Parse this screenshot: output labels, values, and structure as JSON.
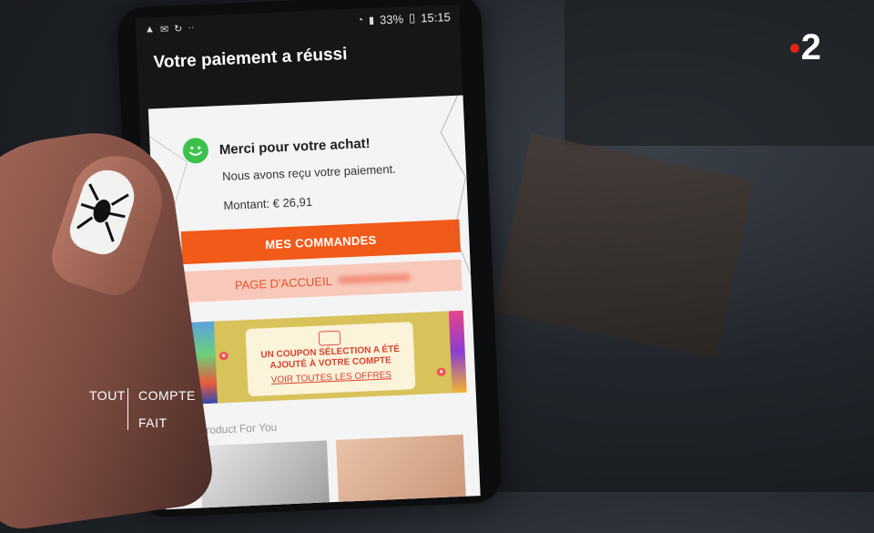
{
  "status_bar": {
    "battery": "33%",
    "time": "15:15",
    "overflow": "··"
  },
  "app_bar": {
    "title": "Votre paiement a réussi"
  },
  "confirmation": {
    "thanks": "Merci pour votre achat!",
    "received": "Nous avons reçu votre paiement.",
    "amount": "Montant: € 26,91"
  },
  "buttons": {
    "orders": "MES COMMANDES",
    "home": "PAGE D'ACCUEIL"
  },
  "banner": {
    "coupon_line1": "UN COUPON SÉLECTION A ÉTÉ",
    "coupon_line2": "AJOUTÉ À VOTRE COMPTE",
    "coupon_link": "VOIR TOUTES LES OFFRES"
  },
  "products": {
    "section_title": "Product For You"
  },
  "overlay": {
    "channel": "2",
    "show_word1": "TOUT",
    "show_word2": "COMPTE",
    "show_word3": "FAIT"
  },
  "colors": {
    "primary_button": "#f25a1a",
    "secondary_button": "#f8c9bb",
    "success": "#3cc24a",
    "channel_dot": "#e2231a"
  }
}
